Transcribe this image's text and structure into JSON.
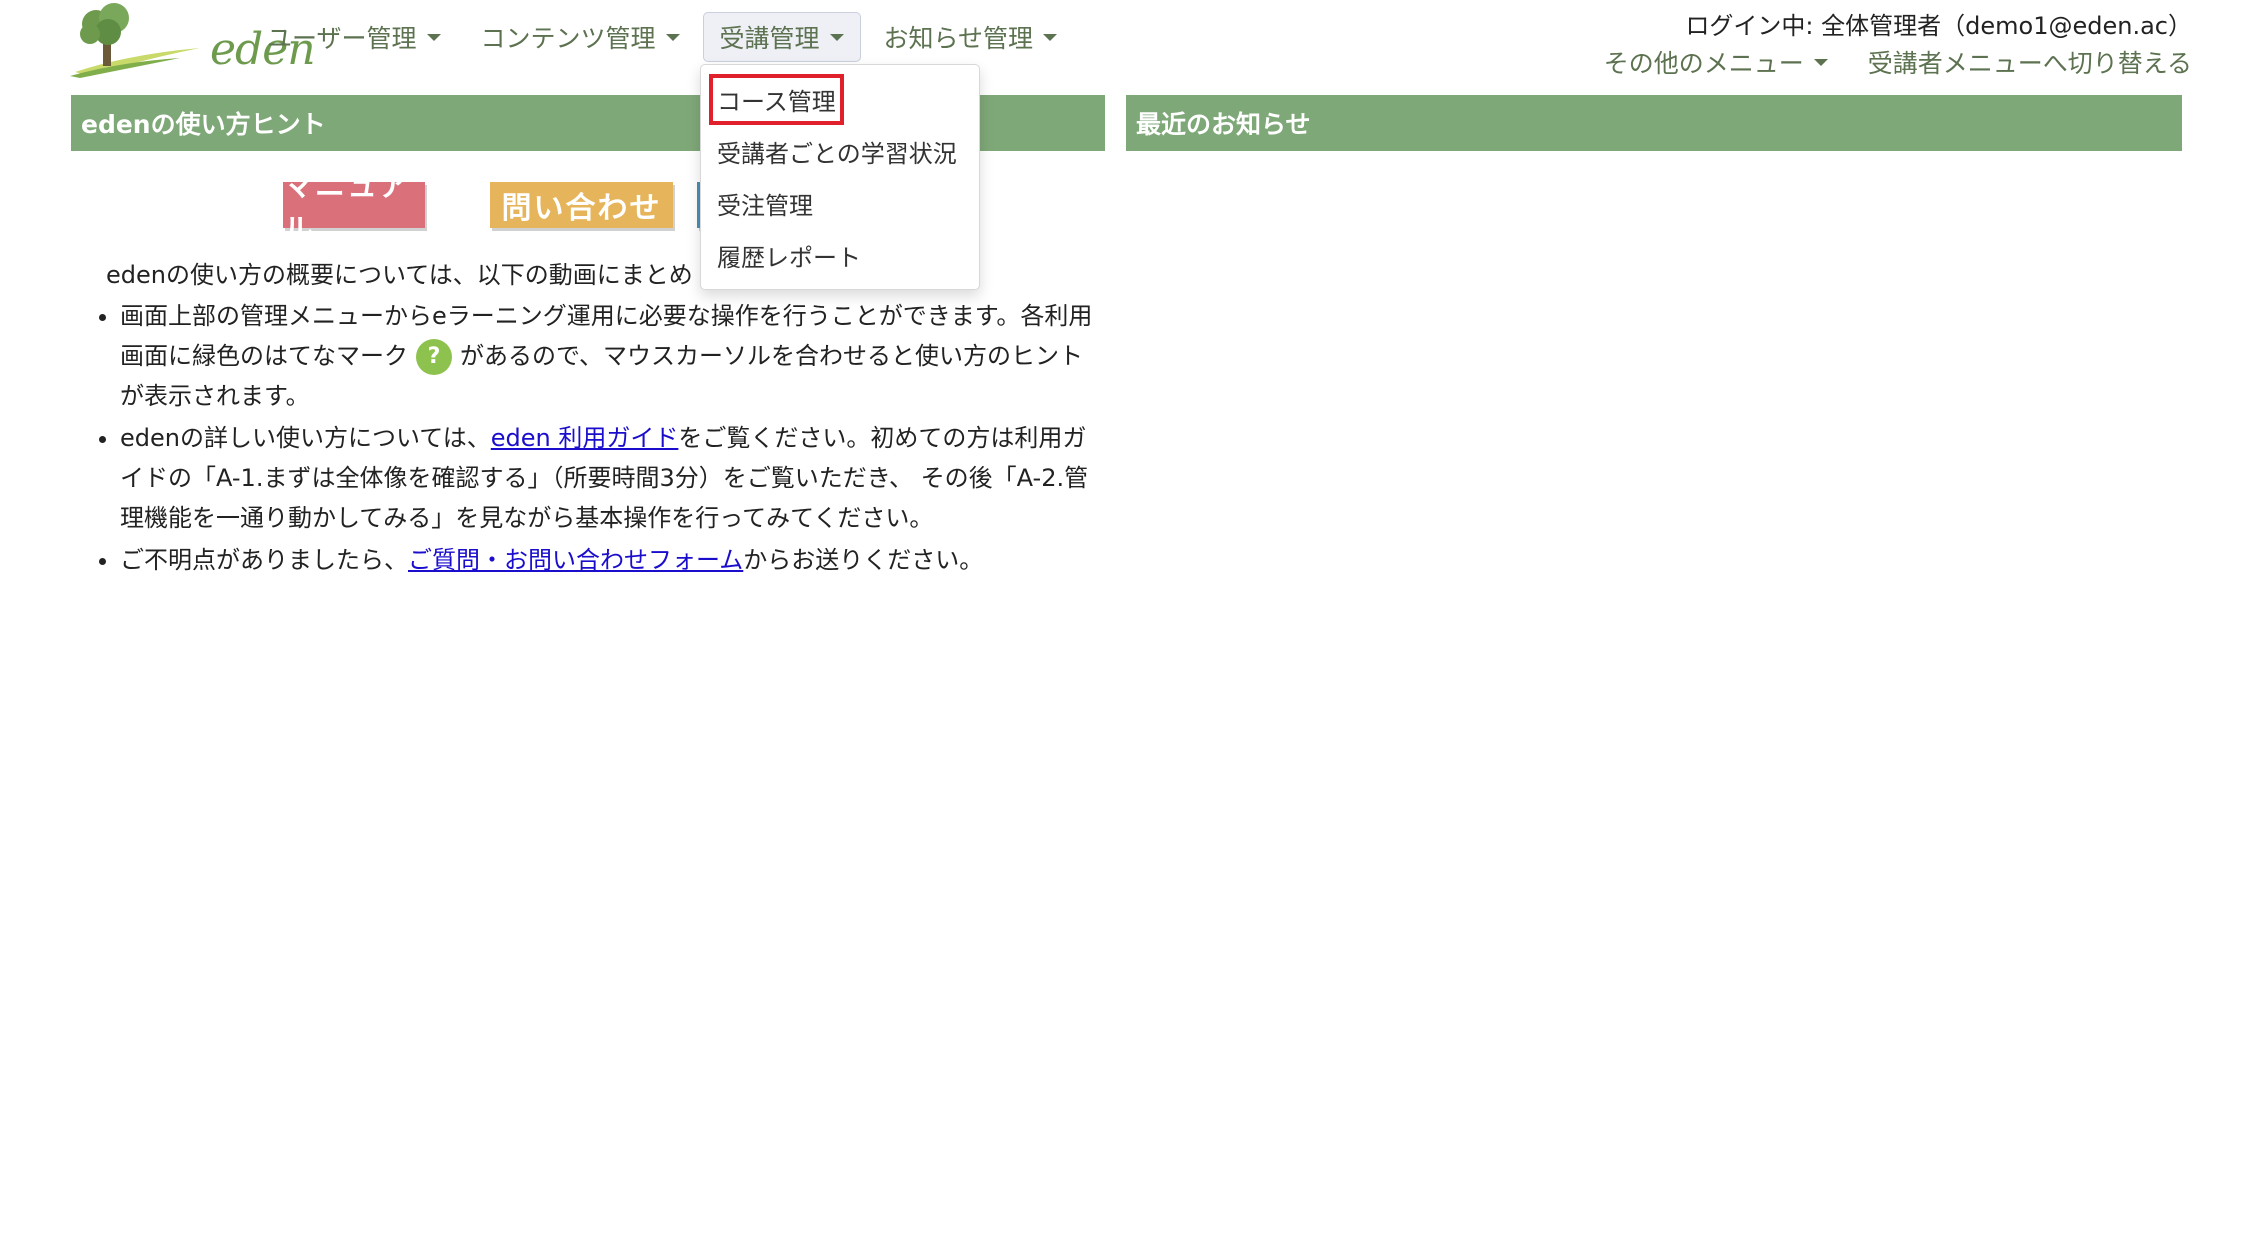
{
  "header": {
    "logo_text": "eden",
    "nav": [
      {
        "label": "ユーザー管理"
      },
      {
        "label": "コンテンツ管理"
      },
      {
        "label": "受講管理"
      },
      {
        "label": "お知らせ管理"
      }
    ],
    "login_info": "ログイン中: 全体管理者（demo1@eden.ac）",
    "other_menu": "その他のメニュー",
    "switch_menu": "受講者メニューへ切り替える"
  },
  "dropdown": {
    "items": [
      {
        "label": "コース管理"
      },
      {
        "label": "受講者ごとの学習状況"
      },
      {
        "label": "受注管理"
      },
      {
        "label": "履歴レポート"
      }
    ]
  },
  "hint_panel": {
    "title": "edenの使い方ヒント",
    "buttons": {
      "manual": "マニュアル",
      "inquiry": "問い合わせ"
    },
    "intro": "edenの使い方の概要については、以下の動画にまとめ",
    "bullet1_a": "画面上部の管理メニューからeラーニング運用に必要な操作を行うことができます。各利用画面に緑色のはてなマーク",
    "bullet1_b": "があるので、マウスカーソルを合わせると使い方のヒントが表示されます。",
    "bullet2_a": "edenの詳しい使い方については、",
    "bullet2_link": "eden 利用ガイド",
    "bullet2_b": "をご覧ください。初めての方は利用ガイドの「A-1.まずは全体像を確認する」（所要時間3分）をご覧いただき、 その後「A-2.管理機能を一通り動かしてみる」を見ながら基本操作を行ってみてください。",
    "bullet3_a": "ご不明点がありましたら、",
    "bullet3_link": "ご質問・お問い合わせフォーム",
    "bullet3_b": "からお送りください。",
    "qmark": "?"
  },
  "news_panel": {
    "title": "最近のお知らせ"
  },
  "colors": {
    "panel_header": "#7fa878",
    "nav_text": "#5d7250",
    "highlight_box": "#e0202a",
    "link": "#1a0dcc"
  }
}
